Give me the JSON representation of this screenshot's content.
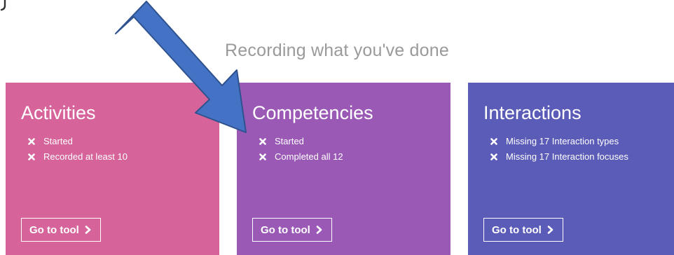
{
  "section": {
    "title": "Recording what you've done"
  },
  "colors": {
    "activities": "#d6649a",
    "competencies": "#9b59b6",
    "interactions": "#5b5cb8",
    "arrow_fill": "#4472c4",
    "arrow_stroke": "#2f528f"
  },
  "cards": [
    {
      "title": "Activities",
      "items": [
        "Started",
        "Recorded at least 10"
      ],
      "button_label": "Go to tool",
      "status_icon": "cross-icon"
    },
    {
      "title": "Competencies",
      "items": [
        "Started",
        "Completed all 12"
      ],
      "button_label": "Go to tool",
      "status_icon": "cross-icon"
    },
    {
      "title": "Interactions",
      "items": [
        "Missing 17 Interaction types",
        "Missing 17 Interaction focuses"
      ],
      "button_label": "Go to tool",
      "status_icon": "cross-icon"
    }
  ],
  "button_icon": "chevron-right-icon",
  "annotation": {
    "icon": "arrow-callout-icon"
  }
}
